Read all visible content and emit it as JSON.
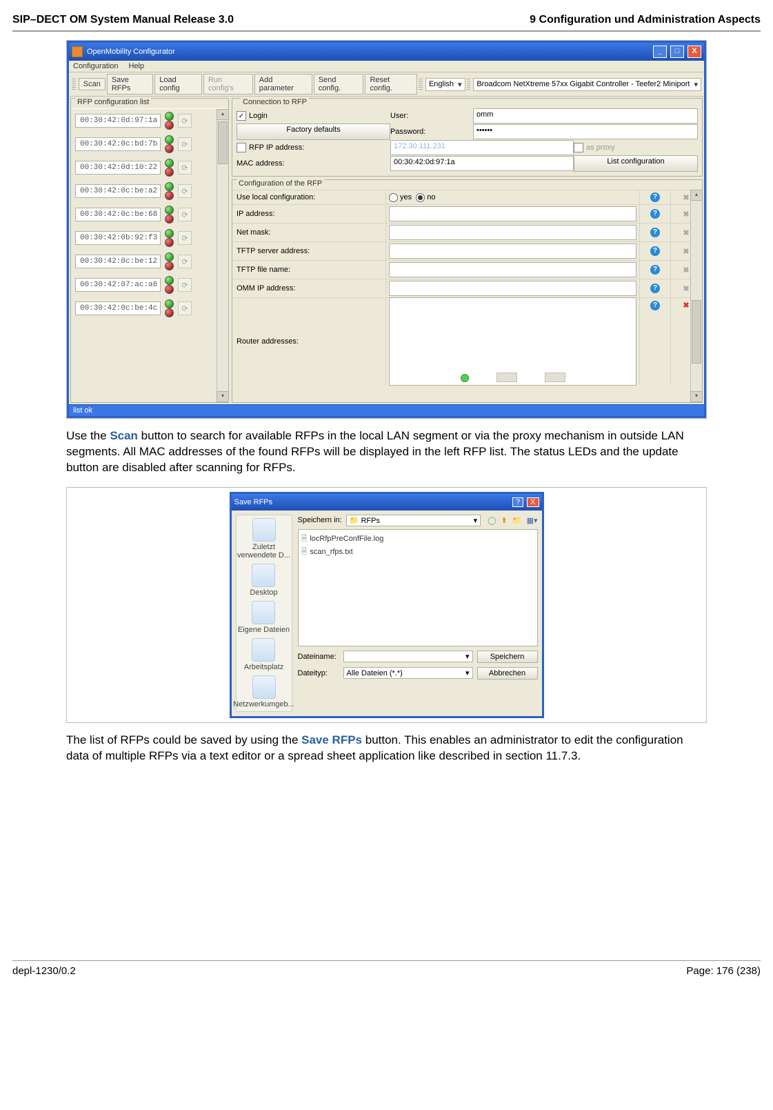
{
  "header": {
    "left": "SIP–DECT OM System Manual Release 3.0",
    "right": "9 Configuration und Administration Aspects"
  },
  "footer": {
    "left": "depl-1230/0.2",
    "right": "Page: 176 (238)"
  },
  "figure1": {
    "window_title": "OpenMobility Configurator",
    "menu": {
      "configuration": "Configuration",
      "help": "Help"
    },
    "toolbar": {
      "scan": "Scan",
      "save_rfps": "Save RFPs",
      "load_config": "Load config",
      "run_configs": "Run config's",
      "add_parameter": "Add parameter",
      "send_config": "Send config.",
      "reset_config": "Reset config.",
      "language": "English",
      "nic": "Broadcom NetXtreme 57xx Gigabit Controller - Teefer2 Miniport"
    },
    "left_panel": {
      "title": "RFP configuration list",
      "macs": [
        "00:30:42:0d:97:1a",
        "00:30:42:0c:bd:7b",
        "00:30:42:0d:10:22",
        "00:30:42:0c:be:a2",
        "00:30:42:0c:be:68",
        "00:30:42:0b:92:f3",
        "00:30:42:0c:be:12",
        "00:30:42:07:ac:a6",
        "00:30:42:0c:be:4c"
      ]
    },
    "conn": {
      "title": "Connection to RFP",
      "login": "Login",
      "user_label": "User:",
      "user_value": "omm",
      "factory_defaults": "Factory defaults",
      "password_label": "Password:",
      "password_value": "••••••",
      "rfp_ip_label": "RFP IP address:",
      "rfp_ip_value": "172.30.111.231",
      "as_proxy": "as proxy",
      "mac_label": "MAC address:",
      "mac_value": "00:30:42:0d:97:1a",
      "list_configuration": "List configuration"
    },
    "cfg": {
      "title": "Configuration of the RFP",
      "rows": {
        "use_local": "Use local configuration:",
        "yes": "yes",
        "no": "no",
        "ip": "IP address:",
        "netmask": "Net mask:",
        "tftp_server": "TFTP server address:",
        "tftp_file": "TFTP file name:",
        "omm_ip": "OMM IP address:",
        "router": "Router addresses:"
      }
    },
    "status": "list ok"
  },
  "para1": {
    "pre": "Use the ",
    "scan": "Scan",
    "post": " button to search for available RFPs in the local LAN segment or via the proxy mechanism in outside LAN segments. All MAC addresses of the found RFPs will be displayed in the left RFP list. The status LEDs and the update button are disabled after scanning for RFPs."
  },
  "figure2": {
    "title": "Save RFPs",
    "save_in_label": "Speichern in:",
    "folder": "RFPs",
    "files": [
      "locRfpPreConfFile.log",
      "scan_rfps.txt"
    ],
    "places": {
      "recent": "Zuletzt verwendete D...",
      "desktop": "Desktop",
      "mydocs": "Eigene Dateien",
      "computer": "Arbeitsplatz",
      "network": "Netzwerkumgeb..."
    },
    "filename_label": "Dateiname:",
    "filetype_label": "Dateityp:",
    "filetype_value": "Alle Dateien (*.*)",
    "save_btn": "Speichern",
    "cancel_btn": "Abbrechen"
  },
  "para2": {
    "pre": "The list of RFPs could be saved by using the ",
    "save_rfps": "Save RFPs",
    "post": " button. This enables an administrator to edit the configuration data of multiple RFPs via a text editor or a spread sheet application like described in section 11.7.3."
  }
}
